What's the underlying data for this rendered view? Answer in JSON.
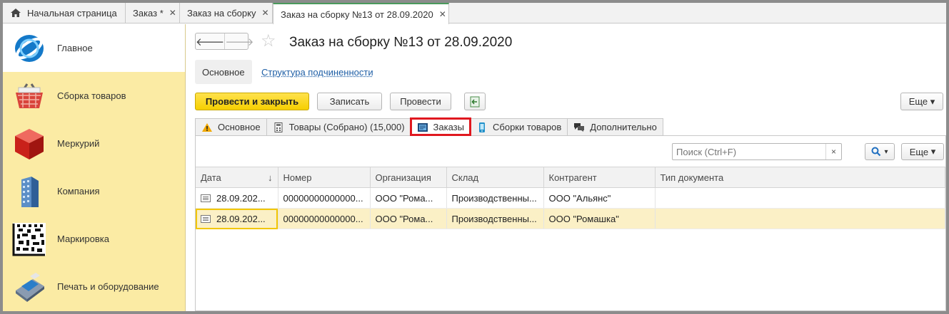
{
  "window_tabs": [
    {
      "label": "Начальная страница",
      "closable": false,
      "icon": "home-icon"
    },
    {
      "label": "Заказ *",
      "closable": true
    },
    {
      "label": "Заказ на сборку",
      "closable": true
    },
    {
      "label": "Заказ на сборку №13 от 28.09.2020",
      "closable": true,
      "active": true
    }
  ],
  "sidebar": {
    "items": [
      {
        "label": "Главное",
        "icon": "globe-logo-icon"
      },
      {
        "label": "Сборка товаров",
        "icon": "shopping-basket-icon"
      },
      {
        "label": "Меркурий",
        "icon": "red-cube-icon"
      },
      {
        "label": "Компания",
        "icon": "building-icon"
      },
      {
        "label": "Маркировка",
        "icon": "datamatrix-code-icon"
      },
      {
        "label": "Печать и оборудование",
        "icon": "payment-terminal-icon"
      }
    ]
  },
  "document": {
    "title": "Заказ на сборку №13 от 28.09.2020",
    "subnav_main": "Основное",
    "subnav_link": "Структура подчиненности"
  },
  "toolbar": {
    "post_close": "Провести и закрыть",
    "save": "Записать",
    "post": "Провести",
    "more": "Еще"
  },
  "form_tabs": [
    {
      "label": "Основное",
      "icon": "warning-icon"
    },
    {
      "label": "Товары (Собрано) (15,000)",
      "icon": "calculator-icon"
    },
    {
      "label": "Заказы",
      "icon": "orders-icon",
      "selected": true
    },
    {
      "label": "Сборки товаров",
      "icon": "phone-icon"
    },
    {
      "label": "Дополнительно",
      "icon": "chat-icon"
    }
  ],
  "list_panel": {
    "search_placeholder": "Поиск (Ctrl+F)",
    "search_clear": "×",
    "more": "Еще"
  },
  "table": {
    "columns": [
      "Дата",
      "Номер",
      "Организация",
      "Склад",
      "Контрагент",
      "Тип документа"
    ],
    "rows": [
      [
        "28.09.202...",
        "00000000000000...",
        "ООО \"Рома...",
        "Производственны...",
        "ООО \"Альянс\"",
        ""
      ],
      [
        "28.09.202...",
        "00000000000000...",
        "ООО \"Рома...",
        "Производственны...",
        "ООО \"Ромашка\"",
        ""
      ]
    ],
    "selected_row": 1
  },
  "colors": {
    "sidebar_bg": "#fbeba4",
    "primary_button": "#f6cf00",
    "active_tab_accent": "#4a9a5c",
    "highlight_red": "#e0181f",
    "selected_row": "#fbf0c6"
  }
}
